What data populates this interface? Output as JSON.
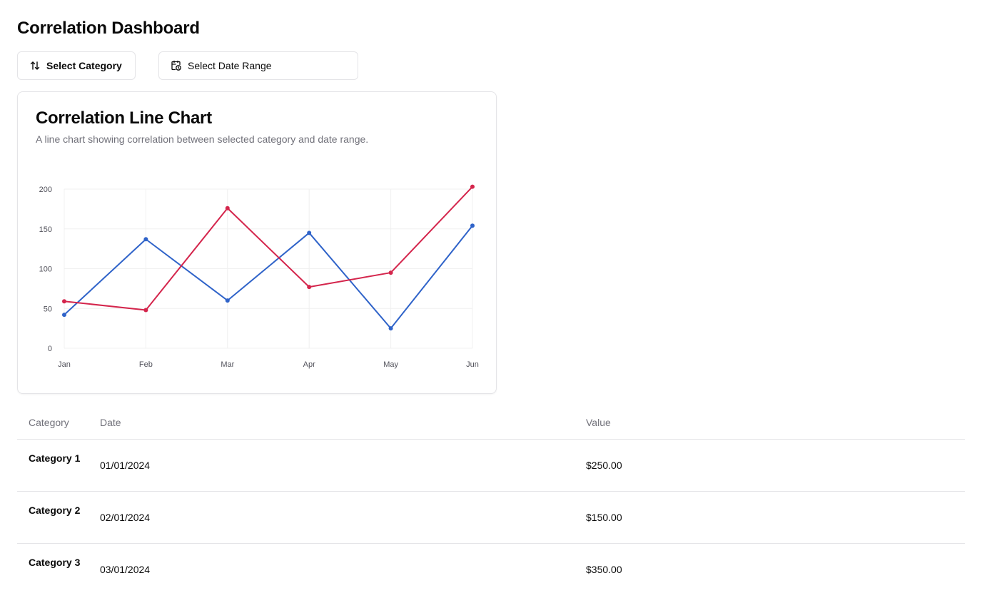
{
  "page": {
    "title": "Correlation Dashboard"
  },
  "toolbar": {
    "category_button": {
      "label": "Select Category",
      "icon": "arrow-up-down-icon"
    },
    "date_button": {
      "label": "Select Date Range",
      "icon": "calendar-clock-icon"
    }
  },
  "card": {
    "title": "Correlation Line Chart",
    "description": "A line chart showing correlation between selected category and date range."
  },
  "chart_data": {
    "type": "line",
    "categories": [
      "Jan",
      "Feb",
      "Mar",
      "Apr",
      "May",
      "Jun"
    ],
    "series": [
      {
        "color": "#2f63c9",
        "values": [
          42,
          137,
          60,
          145,
          25,
          154
        ]
      },
      {
        "color": "#d4254c",
        "values": [
          59,
          48,
          176,
          77,
          95,
          203
        ]
      }
    ],
    "ylim": [
      0,
      200
    ],
    "yticks": [
      0,
      50,
      100,
      150,
      200
    ],
    "grid": true,
    "title": "",
    "xlabel": "",
    "ylabel": ""
  },
  "table": {
    "headers": [
      "Category",
      "Date",
      "Value"
    ],
    "rows": [
      {
        "category": "Category 1",
        "date": "01/01/2024",
        "value": "$250.00"
      },
      {
        "category": "Category 2",
        "date": "02/01/2024",
        "value": "$150.00"
      },
      {
        "category": "Category 3",
        "date": "03/01/2024",
        "value": "$350.00"
      }
    ]
  }
}
